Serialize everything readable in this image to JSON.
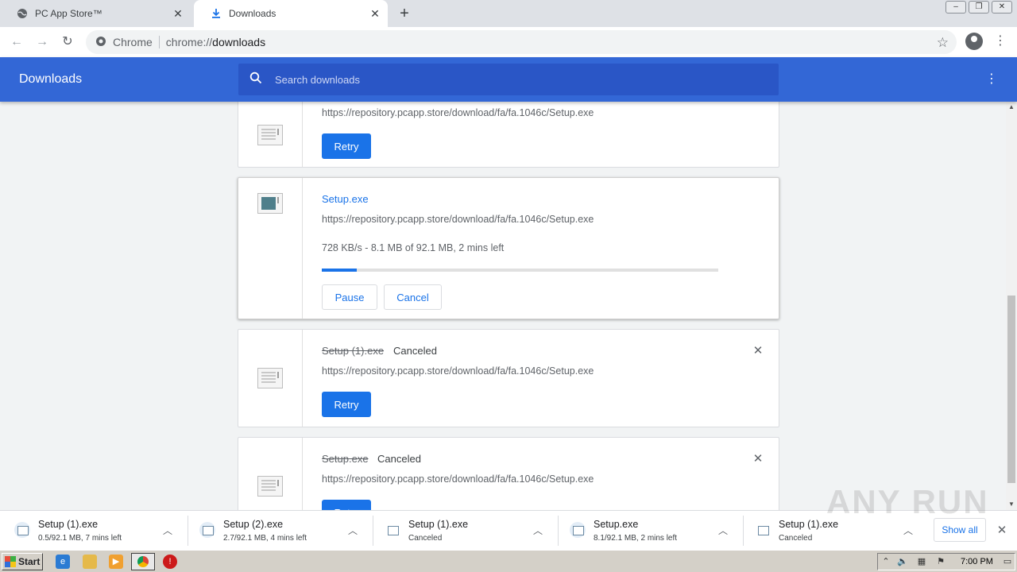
{
  "tabs": [
    {
      "title": "PC App Store™",
      "icon": "globe-icon"
    },
    {
      "title": "Downloads",
      "icon": "download-icon"
    }
  ],
  "omnibox": {
    "scheme_label": "Chrome",
    "url_scheme": "chrome://",
    "url_host": "downloads"
  },
  "header": {
    "title": "Downloads",
    "search_placeholder": "Search downloads"
  },
  "downloads": [
    {
      "url": "https://repository.pcapp.store/download/fa/fa.1046c/Setup.exe",
      "action": "Retry"
    },
    {
      "name": "Setup.exe",
      "url": "https://repository.pcapp.store/download/fa/fa.1046c/Setup.exe",
      "progress_text": "728 KB/s - 8.1 MB of 92.1 MB, 2 mins left",
      "progress_fraction": 0.088,
      "pause": "Pause",
      "cancel": "Cancel"
    },
    {
      "name": "Setup (1).exe",
      "status": "Canceled",
      "url": "https://repository.pcapp.store/download/fa/fa.1046c/Setup.exe",
      "action": "Retry"
    },
    {
      "name": "Setup.exe",
      "status": "Canceled",
      "url": "https://repository.pcapp.store/download/fa/fa.1046c/Setup.exe",
      "action": "Retry"
    }
  ],
  "shelf": {
    "items": [
      {
        "name": "Setup (1).exe",
        "status": "0.5/92.1 MB, 7 mins left"
      },
      {
        "name": "Setup (2).exe",
        "status": "2.7/92.1 MB, 4 mins left"
      },
      {
        "name": "Setup (1).exe",
        "status": "Canceled"
      },
      {
        "name": "Setup.exe",
        "status": "8.1/92.1 MB, 2 mins left"
      },
      {
        "name": "Setup (1).exe",
        "status": "Canceled"
      }
    ],
    "show_all": "Show all"
  },
  "watermark": "ANY RUN",
  "taskbar": {
    "start": "Start",
    "clock": "7:00 PM"
  }
}
